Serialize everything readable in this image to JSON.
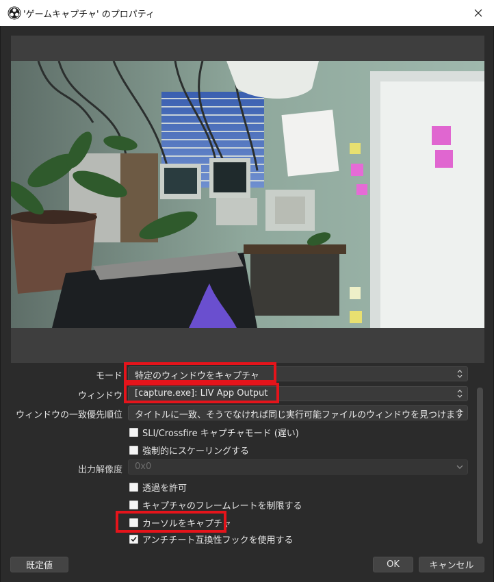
{
  "window": {
    "title": "'ゲームキャプチャ' のプロパティ",
    "close_glyph": "✕"
  },
  "properties": {
    "mode": {
      "label": "モード",
      "value": "特定のウィンドウをキャプチャ"
    },
    "window": {
      "label": "ウィンドウ",
      "value": "[capture.exe]: LIV App Output"
    },
    "match_priority": {
      "label": "ウィンドウの一致優先順位",
      "value": "タイトルに一致、そうでなければ同じ実行可能ファイルのウィンドウを見つけます"
    },
    "sli_crossfire": {
      "label": "SLI/Crossfire キャプチャモード (遅い)",
      "checked": false
    },
    "force_scaling": {
      "label": "強制的にスケーリングする",
      "checked": false
    },
    "output_resolution": {
      "label": "出力解像度",
      "value": "0x0",
      "disabled": true
    },
    "allow_transparency": {
      "label": "透過を許可",
      "checked": false
    },
    "limit_framerate": {
      "label": "キャプチャのフレームレートを制限する",
      "checked": false
    },
    "capture_cursor": {
      "label": "カーソルをキャプチャ",
      "checked": false
    },
    "anticheat_hook": {
      "label": "アンチチート互換性フックを使用する",
      "checked": true
    }
  },
  "buttons": {
    "defaults": "既定値",
    "ok": "OK",
    "cancel": "キャンセル"
  },
  "colors": {
    "highlight": "#e5141b",
    "background": "#2b2b2b"
  }
}
